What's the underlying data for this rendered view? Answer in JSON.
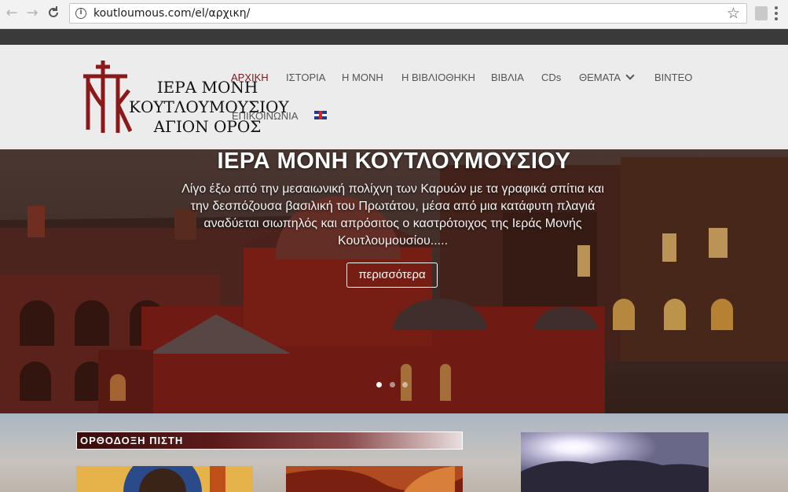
{
  "browser": {
    "url": "koutloumous.com/el/αρχικη/",
    "back_icon": "arrow-left-icon",
    "forward_icon": "arrow-right-icon",
    "reload_icon": "reload-icon",
    "info_icon": "info-icon",
    "star_icon": "star-icon"
  },
  "logo": {
    "line1": "ΙΕΡΑ ΜΟΝΗ",
    "line2": "ΚΟΥΤΛΟΥΜΟΥΣΙΟΥ",
    "line3": "ΑΓΙΟΝ ΟΡΟΣ"
  },
  "nav": {
    "items": [
      {
        "label": "ΑΡΧΙΚΗ",
        "active": true
      },
      {
        "label": "ΙΣΤΟΡΙΑ"
      },
      {
        "label": "Η ΜΟΝΗ"
      },
      {
        "label": "Η ΒΙΒΛΙΟΘΗΚΗ"
      },
      {
        "label": "ΒΙΒΛΙΑ"
      },
      {
        "label": "CDs"
      },
      {
        "label": "ΘΕΜΑΤΑ"
      },
      {
        "label": "ΒΙΝΤΕΟ"
      },
      {
        "label": "ΕΠΙΚΟΙΝΩΝΙΑ"
      }
    ],
    "flag_icon": "uk-flag-icon"
  },
  "hero": {
    "title": "ΙΕΡΑ ΜΟΝΗ ΚΟΥΤΛΟΥΜΟΥΣΙΟΥ",
    "line1": "Λίγο έξω από την μεσαιωνική πολίχνη των Καρυών με τα γραφικά σπίτια και",
    "line2": "την δεσπόζουσα βασιλική του Πρωτάτου, μέσα από μια κατάφυτη πλαγιά",
    "line3": "αναδύεται σιωπηλός και απρόσιτος ο καστρότοιχος της Ιεράς Μονής",
    "line4": "Κουτλουμουσίου.....",
    "button": "περισσότερα",
    "slides": 3,
    "active_slide": 1
  },
  "content": {
    "section_title": "ΟΡΘΟΔΟΞΗ ΠΙΣΤΗ"
  },
  "colors": {
    "accent": "#7a1a1a",
    "header_bg": "#ececec",
    "topbar": "#3a3a3a"
  }
}
